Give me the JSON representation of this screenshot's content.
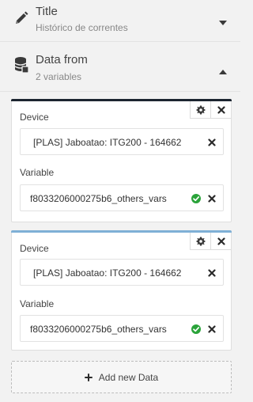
{
  "title_section": {
    "label": "Title",
    "value": "Histórico de correntes",
    "icon": "pencil-icon"
  },
  "data_from_section": {
    "label": "Data from",
    "summary": "2 variables",
    "icon": "database-icon"
  },
  "data_cards": [
    {
      "accent_color": "#1c2530",
      "device_label": "Device",
      "device_value": "[PLAS] Jaboatao: ITG200 - 164662",
      "variable_label": "Variable",
      "variable_value": "f8033206000275b6_others_vars"
    },
    {
      "accent_color": "#7fb0d6",
      "device_label": "Device",
      "device_value": "[PLAS] Jaboatao: ITG200 - 164662",
      "variable_label": "Variable",
      "variable_value": "f8033206000275b6_others_vars"
    }
  ],
  "add_button": {
    "label": "Add new Data"
  },
  "colors": {
    "check_green": "#2aa33a",
    "icon_dark": "#3a3a3a"
  }
}
